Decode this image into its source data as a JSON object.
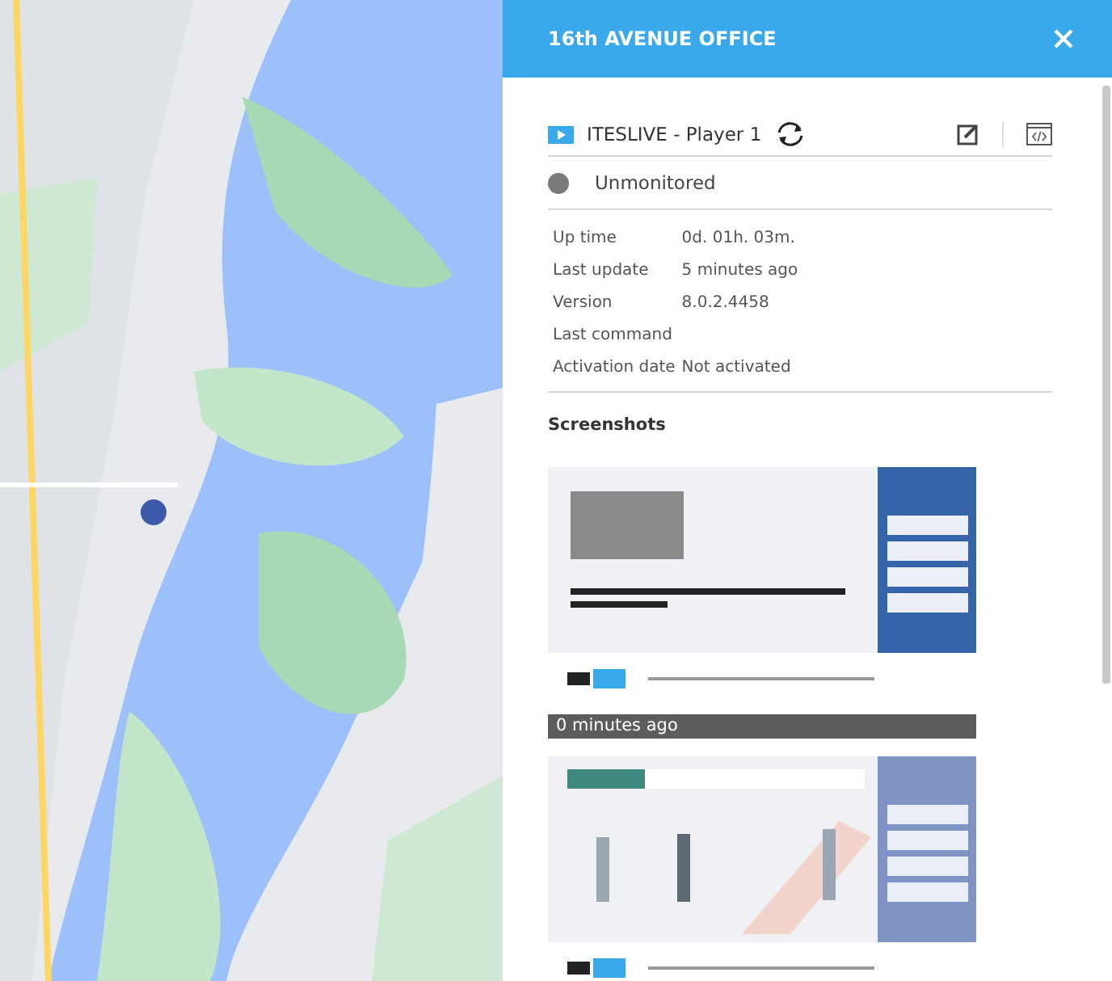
{
  "map": {
    "kind": "picture"
  },
  "panel": {
    "title": "16th AVENUE OFFICE",
    "player": {
      "name": "ITESLIVE - Player 1"
    },
    "status": {
      "label": "Unmonitored"
    },
    "details": [
      {
        "label": "Up time",
        "value": "0d. 01h. 03m."
      },
      {
        "label": "Last update",
        "value": "5 minutes ago"
      },
      {
        "label": "Version",
        "value": "8.0.2.4458"
      },
      {
        "label": "Last command"
      },
      {
        "label": "Activation date",
        "value": "Not activated"
      }
    ],
    "screenshots": {
      "heading": "Screenshots",
      "items": [
        {
          "kind": "picture",
          "caption": "0 minutes ago"
        },
        {
          "kind": "picture"
        }
      ]
    }
  }
}
